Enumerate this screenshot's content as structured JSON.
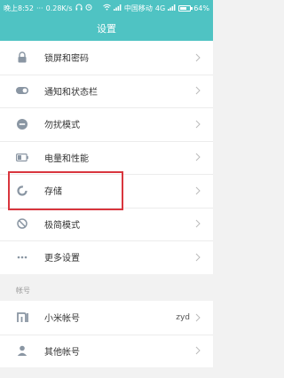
{
  "status_bar": {
    "time": "晚上8:52",
    "speed": "0.28K/s",
    "carrier": "中国移动",
    "network": "4G",
    "battery": "64%",
    "battery_level": 0.64
  },
  "header": {
    "title": "设置"
  },
  "settings": [
    {
      "label": "锁屏和密码",
      "icon": "lock-icon"
    },
    {
      "label": "通知和状态栏",
      "icon": "toggle-icon"
    },
    {
      "label": "勿扰模式",
      "icon": "do-not-disturb-icon"
    },
    {
      "label": "电量和性能",
      "icon": "battery-icon"
    },
    {
      "label": "存储",
      "icon": "storage-icon"
    },
    {
      "label": "极简模式",
      "icon": "simple-mode-icon"
    },
    {
      "label": "更多设置",
      "icon": "more-dots-icon"
    }
  ],
  "accounts_section": {
    "header": "帐号",
    "items": [
      {
        "label": "小米帐号",
        "value": "zyd",
        "icon": "mi-logo-icon"
      },
      {
        "label": "其他帐号",
        "icon": "person-icon"
      }
    ]
  },
  "colors": {
    "accent": "#4fc3c3",
    "icon": "#8a96a3",
    "highlight": "#d9363e"
  }
}
